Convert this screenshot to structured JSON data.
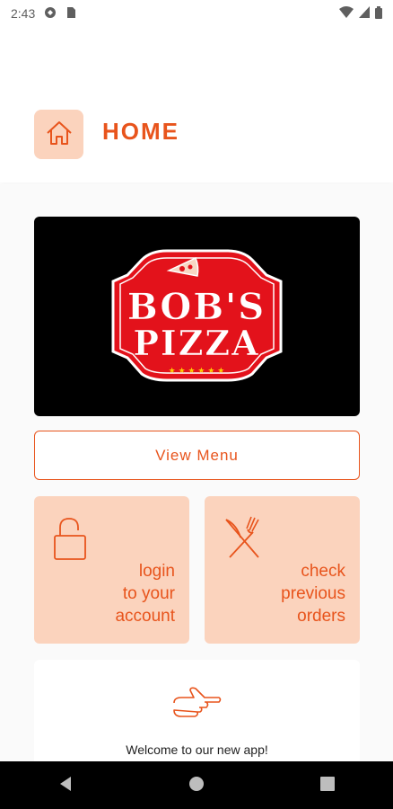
{
  "status_bar": {
    "time": "2:43"
  },
  "header": {
    "title": "HOME",
    "icon": "home-icon"
  },
  "banner": {
    "logo_line1": "BOB'S",
    "logo_line2": "PIZZA"
  },
  "actions": {
    "view_menu_label": "View Menu",
    "login_label": "login\nto your\naccount",
    "orders_label": "check\nprevious\norders"
  },
  "welcome": {
    "text": "Welcome to our new app!"
  },
  "colors": {
    "accent": "#e8541c",
    "tile_bg": "#fbd3bd",
    "logo_red": "#e3121b"
  }
}
